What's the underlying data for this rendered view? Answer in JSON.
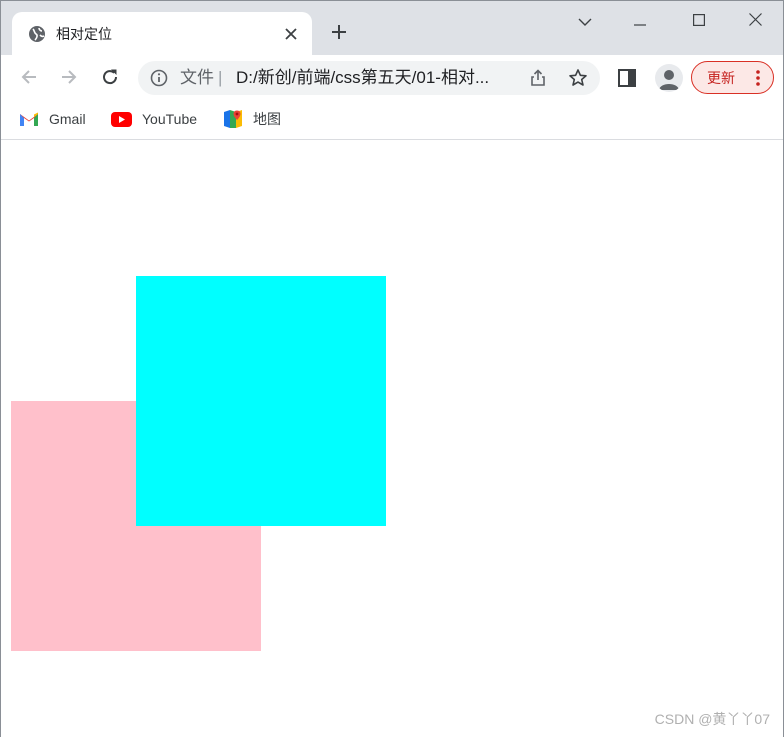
{
  "tab": {
    "title": "相对定位",
    "favicon": "globe-icon",
    "close_icon": "close-icon"
  },
  "window_controls": {
    "tab_search_icon": "chevron-down-icon",
    "minimize_icon": "minimize-icon",
    "maximize_icon": "maximize-icon",
    "close_icon": "close-icon"
  },
  "toolbar": {
    "back_icon": "back-arrow-icon",
    "forward_icon": "forward-arrow-icon",
    "reload_icon": "reload-icon",
    "omnibox": {
      "scheme_label": "文件",
      "separator": "|",
      "url": "D:/新创/前端/css第五天/01-相对..."
    },
    "update_label": "更新"
  },
  "bookmarks": [
    {
      "label": "Gmail",
      "icon": "gmail-icon"
    },
    {
      "label": "YouTube",
      "icon": "youtube-icon"
    },
    {
      "label": "地图",
      "icon": "maps-icon"
    }
  ],
  "page": {
    "boxes": [
      {
        "name": "pink-box",
        "color": "#ffc0cb"
      },
      {
        "name": "cyan-box",
        "color": "#00ffff"
      }
    ],
    "watermark": "CSDN @黄丫丫07"
  },
  "colors": {
    "tabstrip": "#dee1e6",
    "accent_update": "#d93025"
  }
}
